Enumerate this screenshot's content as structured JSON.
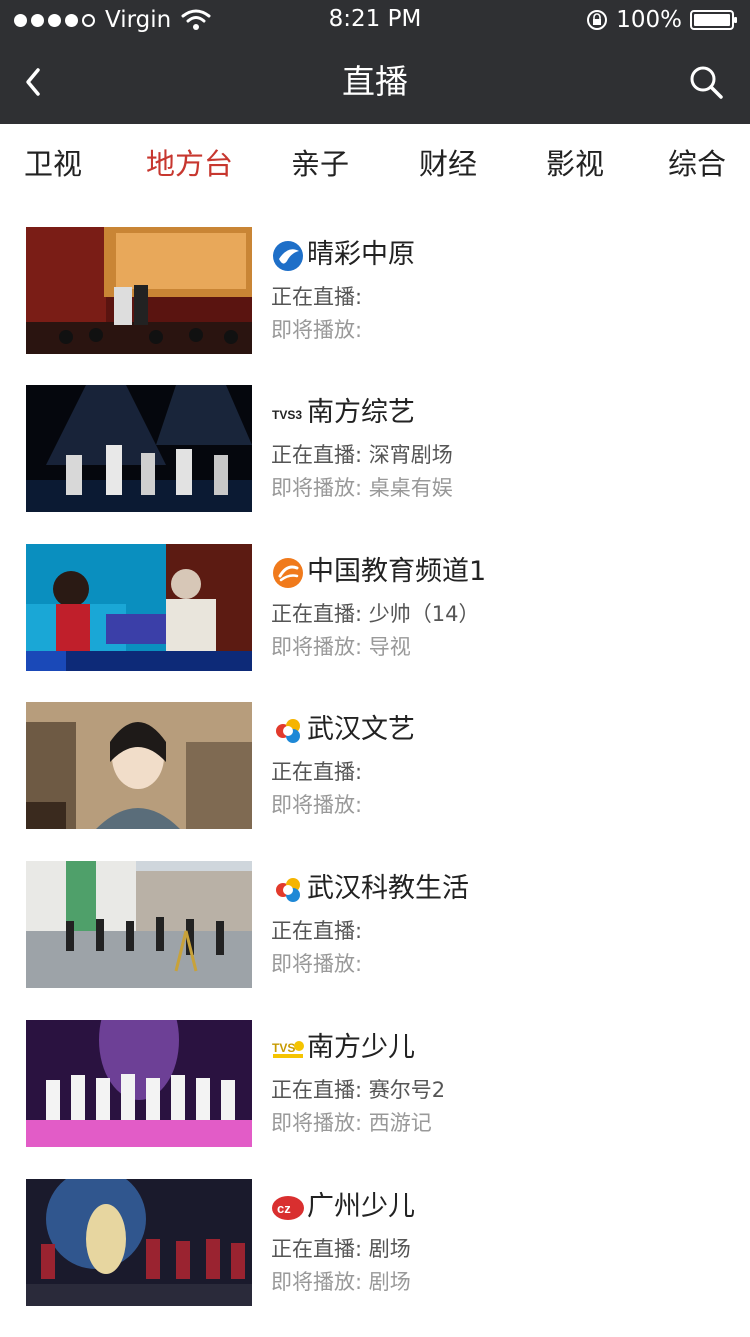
{
  "status_bar": {
    "carrier": "Virgin",
    "time": "8:21 PM",
    "battery": "100%",
    "signal_bars_filled": 4,
    "signal_bars_total": 5
  },
  "nav": {
    "title": "直播",
    "back_icon": "chevron-left-icon",
    "search_icon": "search-icon"
  },
  "tabs": [
    {
      "label": "卫视",
      "active": false
    },
    {
      "label": "地方台",
      "active": true
    },
    {
      "label": "亲子",
      "active": false
    },
    {
      "label": "财经",
      "active": false
    },
    {
      "label": "影视",
      "active": false
    },
    {
      "label": "综合",
      "active": false
    }
  ],
  "colors": {
    "bar_bg": "#2f3033",
    "active_tab": "#c7372f"
  },
  "channels": [
    {
      "name": "晴彩中原",
      "now_label": "正在直播:",
      "now_value": "",
      "next_label": "即将播放:",
      "next_value": "",
      "logo": "qingcai-zhongyuan-logo"
    },
    {
      "name": "南方综艺",
      "now_label": "正在直播:",
      "now_value": "深宵剧场",
      "next_label": "即将播放:",
      "next_value": "桌桌有娱",
      "logo": "tvs-variety-logo"
    },
    {
      "name": "中国教育频道1",
      "now_label": "正在直播:",
      "now_value": "少帅（14）",
      "next_label": "即将播放:",
      "next_value": "导视",
      "logo": "cetv-logo"
    },
    {
      "name": "武汉文艺",
      "now_label": "正在直播:",
      "now_value": "",
      "next_label": "即将播放:",
      "next_value": "",
      "logo": "wuhan-tv-logo"
    },
    {
      "name": "武汉科教生活",
      "now_label": "正在直播:",
      "now_value": "",
      "next_label": "即将播放:",
      "next_value": "",
      "logo": "wuhan-tv-logo"
    },
    {
      "name": "南方少儿",
      "now_label": "正在直播:",
      "now_value": "赛尔号2",
      "next_label": "即将播放:",
      "next_value": "西游记",
      "logo": "tvs-kids-logo"
    },
    {
      "name": "广州少儿",
      "now_label": "正在直播:",
      "now_value": "剧场",
      "next_label": "即将播放:",
      "next_value": "剧场",
      "logo": "gz-logo"
    }
  ]
}
